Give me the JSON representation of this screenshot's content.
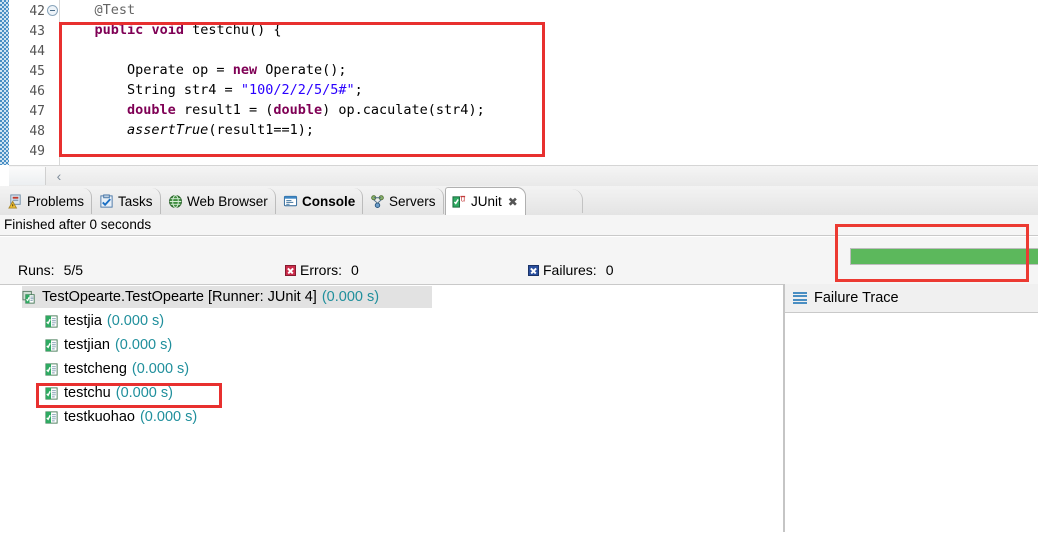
{
  "editor": {
    "lines": [
      {
        "num": "42",
        "folding": true,
        "text": "    @Test"
      },
      {
        "num": "43",
        "folding": false,
        "text": "    public void testchu() {"
      },
      {
        "num": "44",
        "folding": false,
        "text": ""
      },
      {
        "num": "45",
        "folding": false,
        "text": "        Operate op = new Operate();"
      },
      {
        "num": "46",
        "folding": false,
        "text": "        String str4 = \"100/2/2/5/5#\";"
      },
      {
        "num": "47",
        "folding": false,
        "text": "        double result1 = (double) op.caculate(str4);"
      },
      {
        "num": "48",
        "folding": false,
        "text": "        assertTrue(result1==1);"
      },
      {
        "num": "49",
        "folding": false,
        "text": ""
      }
    ],
    "scroll_left_arrow": "‹",
    "highlight_color": "#e8302f"
  },
  "tabs": [
    {
      "label": "Problems",
      "icon": "problems-icon",
      "active": false,
      "bold": false,
      "closeable": false
    },
    {
      "label": "Tasks",
      "icon": "tasks-icon",
      "active": false,
      "bold": false,
      "closeable": false
    },
    {
      "label": "Web Browser",
      "icon": "web-browser-icon",
      "active": false,
      "bold": false,
      "closeable": false
    },
    {
      "label": "Console",
      "icon": "console-icon",
      "active": false,
      "bold": true,
      "closeable": false
    },
    {
      "label": "Servers",
      "icon": "servers-icon",
      "active": false,
      "bold": false,
      "closeable": false
    },
    {
      "label": "JUnit",
      "icon": "junit-icon",
      "active": true,
      "bold": false,
      "closeable": true,
      "close_glyph": "✖"
    }
  ],
  "junit": {
    "status_text": "Finished after 0 seconds",
    "counters": [
      {
        "label": "Runs:",
        "value": "5/5",
        "icon": null,
        "icon_color": null
      },
      {
        "label": "Errors:",
        "value": "0",
        "icon": "error-icon",
        "icon_color": "#cc2b4a"
      },
      {
        "label": "Failures:",
        "value": "0",
        "icon": "failure-icon",
        "icon_color": "#2a4f9e"
      }
    ],
    "progress": {
      "percent": 100,
      "color": "#5cb85c",
      "highlight_color": "#ec3a32"
    },
    "tree": [
      {
        "label": "TestOpearte.TestOpearte [Runner: JUnit 4]",
        "time": "(0.000 s)",
        "level": 0,
        "selected": true,
        "highlighted": false,
        "icon": "test-suite-icon"
      },
      {
        "label": "testjia",
        "time": "(0.000 s)",
        "level": 1,
        "selected": false,
        "highlighted": false,
        "icon": "test-pass-icon"
      },
      {
        "label": "testjian",
        "time": "(0.000 s)",
        "level": 1,
        "selected": false,
        "highlighted": false,
        "icon": "test-pass-icon"
      },
      {
        "label": "testcheng",
        "time": "(0.000 s)",
        "level": 1,
        "selected": false,
        "highlighted": false,
        "icon": "test-pass-icon"
      },
      {
        "label": "testchu",
        "time": "(0.000 s)",
        "level": 1,
        "selected": false,
        "highlighted": true,
        "icon": "test-pass-icon"
      },
      {
        "label": "testkuohao",
        "time": "(0.000 s)",
        "level": 1,
        "selected": false,
        "highlighted": false,
        "icon": "test-pass-icon"
      }
    ],
    "failure_trace": {
      "title": "Failure Trace",
      "menu_icon": "hamburger-icon",
      "entries": []
    }
  }
}
